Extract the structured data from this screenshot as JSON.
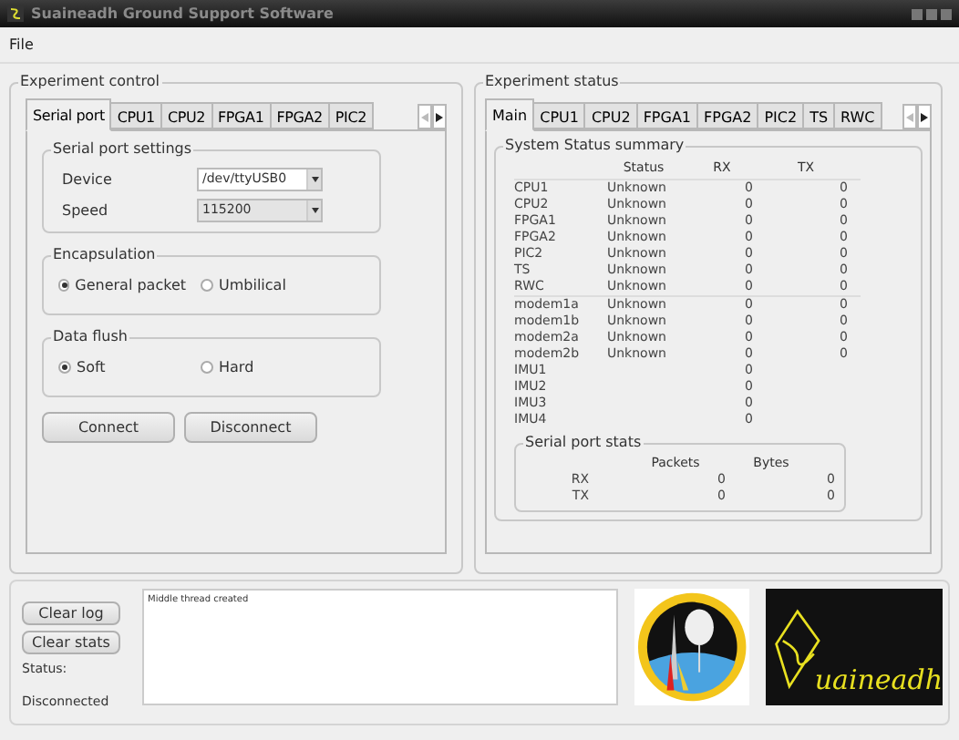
{
  "window": {
    "title": "Suaineadh Ground Support Software"
  },
  "menu": [
    "File"
  ],
  "control": {
    "title": "Experiment control",
    "tabs": [
      {
        "label": "Serial port",
        "selected": true
      },
      {
        "label": "CPU1",
        "selected": false
      },
      {
        "label": "CPU2",
        "selected": false
      },
      {
        "label": "FPGA1",
        "selected": false
      },
      {
        "label": "FPGA2",
        "selected": false
      },
      {
        "label": "PIC2",
        "selected": false
      }
    ],
    "settings": {
      "title": "Serial port settings",
      "fields": [
        {
          "label": "Device",
          "value": "/dev/ttyUSB0",
          "kind": "editable"
        },
        {
          "label": "Speed",
          "value": "115200",
          "kind": "readonly"
        }
      ]
    },
    "radio_groups": [
      {
        "title": "Encapsulation",
        "options": [
          {
            "label": "General packet",
            "selected": true
          },
          {
            "label": "Umbilical",
            "selected": false
          }
        ]
      },
      {
        "title": "Data flush",
        "options": [
          {
            "label": "Soft",
            "selected": true
          },
          {
            "label": "Hard",
            "selected": false
          }
        ]
      }
    ],
    "buttons": [
      "Connect",
      "Disconnect"
    ]
  },
  "status": {
    "title": "Experiment status",
    "tabs": [
      {
        "label": "Main",
        "selected": true
      },
      {
        "label": "CPU1",
        "selected": false
      },
      {
        "label": "CPU2",
        "selected": false
      },
      {
        "label": "FPGA1",
        "selected": false
      },
      {
        "label": "FPGA2",
        "selected": false
      },
      {
        "label": "PIC2",
        "selected": false
      },
      {
        "label": "TS",
        "selected": false
      },
      {
        "label": "RWC",
        "selected": false
      }
    ],
    "summary": {
      "title": "System Status summary",
      "columns": [
        "Status",
        "RX",
        "TX"
      ],
      "sections": [
        [
          {
            "name": "CPU1",
            "status": "Unknown",
            "rx": "0",
            "tx": "0"
          },
          {
            "name": "CPU2",
            "status": "Unknown",
            "rx": "0",
            "tx": "0"
          },
          {
            "name": "FPGA1",
            "status": "Unknown",
            "rx": "0",
            "tx": "0"
          },
          {
            "name": "FPGA2",
            "status": "Unknown",
            "rx": "0",
            "tx": "0"
          },
          {
            "name": "PIC2",
            "status": "Unknown",
            "rx": "0",
            "tx": "0"
          },
          {
            "name": "TS",
            "status": "Unknown",
            "rx": "0",
            "tx": "0"
          },
          {
            "name": "RWC",
            "status": "Unknown",
            "rx": "0",
            "tx": "0"
          }
        ],
        [
          {
            "name": "modem1a",
            "status": "Unknown",
            "rx": "0",
            "tx": "0"
          },
          {
            "name": "modem1b",
            "status": "Unknown",
            "rx": "0",
            "tx": "0"
          },
          {
            "name": "modem2a",
            "status": "Unknown",
            "rx": "0",
            "tx": "0"
          },
          {
            "name": "modem2b",
            "status": "Unknown",
            "rx": "0",
            "tx": "0"
          },
          {
            "name": "IMU1",
            "rx": "0"
          },
          {
            "name": "IMU2",
            "rx": "0"
          },
          {
            "name": "IMU3",
            "rx": "0"
          },
          {
            "name": "IMU4",
            "rx": "0"
          }
        ]
      ]
    },
    "serial_stats": {
      "title": "Serial port stats",
      "columns": [
        "Packets",
        "Bytes"
      ],
      "rows": [
        {
          "name": "RX",
          "packets": "0",
          "bytes": "0"
        },
        {
          "name": "TX",
          "packets": "0",
          "bytes": "0"
        }
      ]
    }
  },
  "bottom": {
    "buttons": [
      "Clear log",
      "Clear stats"
    ],
    "status_label": "Status:",
    "status_value": "Disconnected",
    "log": "Middle thread created",
    "logo_text": "uaineadh"
  }
}
